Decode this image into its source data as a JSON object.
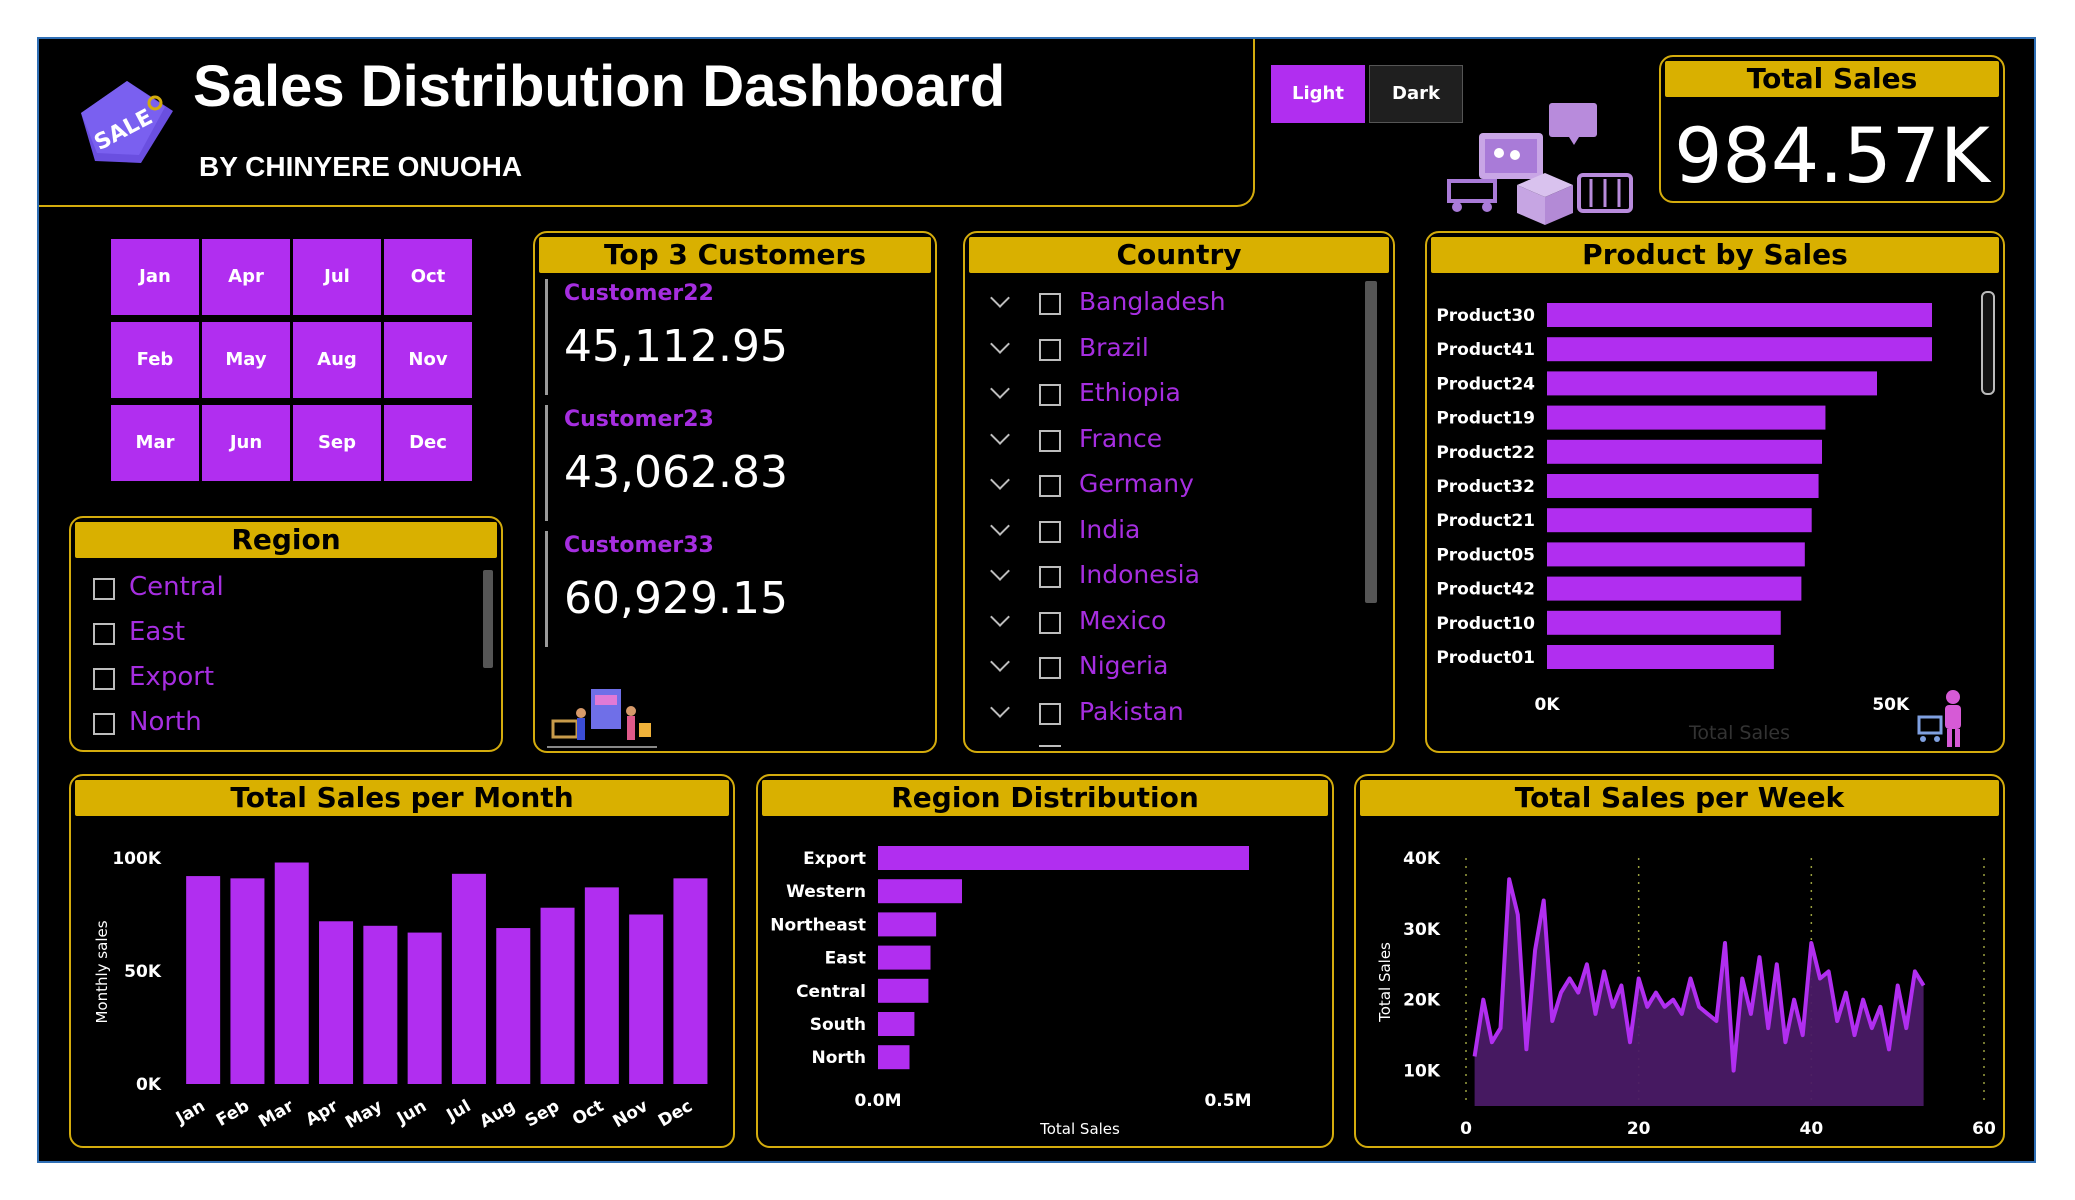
{
  "header": {
    "title": "Sales Distribution Dashboard",
    "subtitle": "BY CHINYERE ONUOHA",
    "logo_text": "SALE"
  },
  "theme_toggle": {
    "light_label": "Light",
    "dark_label": "Dark",
    "active": "Light"
  },
  "total_sales": {
    "title": "Total Sales",
    "value": "984.57K"
  },
  "months": {
    "buttons": [
      "Jan",
      "Apr",
      "Jul",
      "Oct",
      "Feb",
      "May",
      "Aug",
      "Nov",
      "Mar",
      "Jun",
      "Sep",
      "Dec"
    ]
  },
  "region_filter": {
    "title": "Region",
    "items": [
      "Central",
      "East",
      "Export",
      "North"
    ]
  },
  "top_customers": {
    "title": "Top 3 Customers",
    "items": [
      {
        "name": "Customer22",
        "value": "45,112.95"
      },
      {
        "name": "Customer23",
        "value": "43,062.83"
      },
      {
        "name": "Customer33",
        "value": "60,929.15"
      }
    ]
  },
  "country_filter": {
    "title": "Country",
    "items": [
      "Bangladesh",
      "Brazil",
      "Ethiopia",
      "France",
      "Germany",
      "India",
      "Indonesia",
      "Mexico",
      "Nigeria",
      "Pakistan"
    ]
  },
  "colors": {
    "accent": "#a62ee0",
    "bar": "#b12ef0",
    "title_bar": "#d9b000",
    "border": "#d4ac0d",
    "background": "#000000"
  },
  "chart_data": [
    {
      "type": "bar",
      "orientation": "horizontal",
      "title": "Product by Sales",
      "xlabel": "Total Sales",
      "categories": [
        "Product30",
        "Product41",
        "Product24",
        "Product19",
        "Product22",
        "Product32",
        "Product21",
        "Product05",
        "Product42",
        "Product10",
        "Product01"
      ],
      "values": [
        56,
        56,
        48,
        40.5,
        40,
        39.5,
        38.5,
        37.5,
        37,
        34,
        33
      ],
      "xlim": [
        0,
        56
      ],
      "xticks": [
        "0K",
        "50K"
      ],
      "xtick_values": [
        0,
        50
      ]
    },
    {
      "type": "bar",
      "title": "Total Sales per Month",
      "ylabel": "Monthly sales",
      "categories": [
        "Jan",
        "Feb",
        "Mar",
        "Apr",
        "May",
        "Jun",
        "Jul",
        "Aug",
        "Sep",
        "Oct",
        "Nov",
        "Dec"
      ],
      "values": [
        92,
        91,
        98,
        72,
        70,
        67,
        93,
        69,
        78,
        87,
        75,
        91
      ],
      "ylim": [
        0,
        100
      ],
      "yticks": [
        "0K",
        "50K",
        "100K"
      ],
      "ytick_values": [
        0,
        50,
        100
      ]
    },
    {
      "type": "bar",
      "orientation": "horizontal",
      "title": "Region Distribution",
      "xlabel": "Total Sales",
      "categories": [
        "Export",
        "Western",
        "Northeast",
        "East",
        "Central",
        "South",
        "North"
      ],
      "values": [
        0.53,
        0.12,
        0.083,
        0.075,
        0.072,
        0.052,
        0.045
      ],
      "xlim": [
        0,
        0.5
      ],
      "xticks": [
        "0.0M",
        "0.5M"
      ],
      "xtick_values": [
        0,
        0.5
      ]
    },
    {
      "type": "area",
      "title": "Total Sales per Week",
      "ylabel": "Total Sales",
      "x": [
        1,
        2,
        3,
        4,
        5,
        6,
        7,
        8,
        9,
        10,
        11,
        12,
        13,
        14,
        15,
        16,
        17,
        18,
        19,
        20,
        21,
        22,
        23,
        24,
        25,
        26,
        27,
        28,
        29,
        30,
        31,
        32,
        33,
        34,
        35,
        36,
        37,
        38,
        39,
        40,
        41,
        42,
        43,
        44,
        45,
        46,
        47,
        48,
        49,
        50,
        51,
        52,
        53
      ],
      "values": [
        12,
        20,
        14,
        16,
        37,
        32,
        13,
        27,
        34,
        17,
        21,
        23,
        21,
        25,
        18,
        24,
        19,
        22,
        14,
        23,
        19,
        21,
        19,
        20,
        18,
        23,
        19,
        18,
        17,
        28,
        10,
        23,
        18,
        26,
        16,
        25,
        14,
        20,
        15,
        28,
        23,
        24,
        17,
        21,
        15,
        20,
        16,
        19,
        13,
        22,
        16,
        24,
        22
      ],
      "xlim": [
        0,
        60
      ],
      "ylim": [
        5,
        40
      ],
      "xticks": [
        0,
        20,
        40,
        60
      ],
      "yticks": [
        "10K",
        "20K",
        "30K",
        "40K"
      ],
      "ytick_values": [
        10,
        20,
        30,
        40
      ]
    }
  ]
}
